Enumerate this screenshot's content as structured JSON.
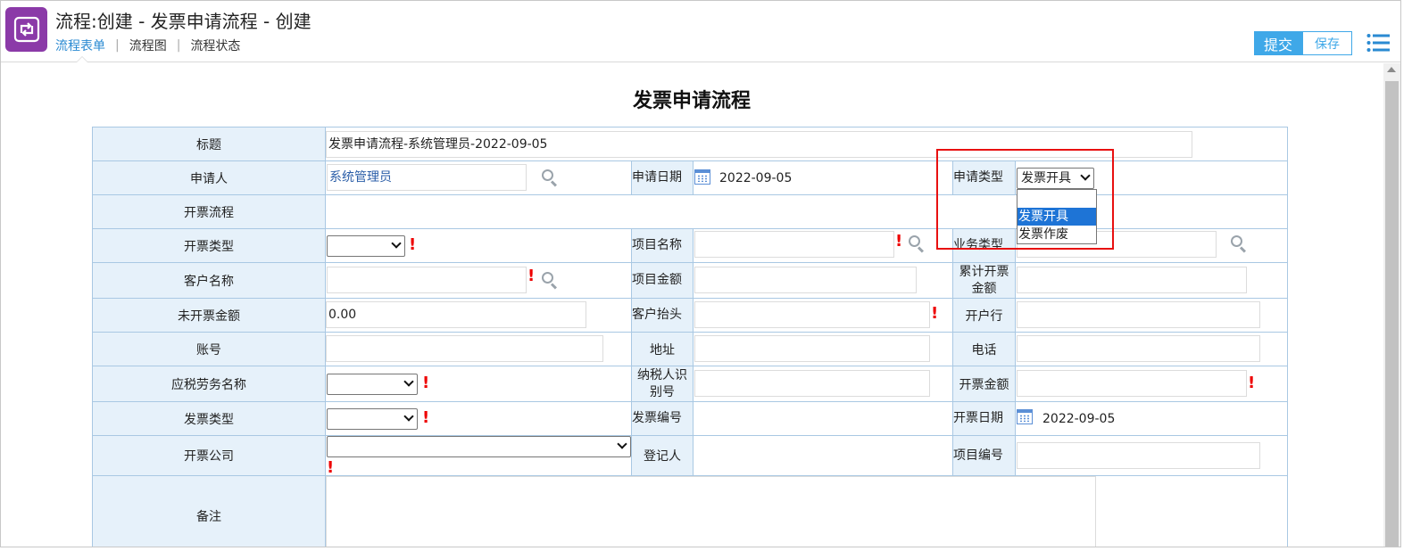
{
  "header": {
    "title": "流程:创建 - 发票申请流程 - 创建",
    "tabs": [
      {
        "label": "流程表单",
        "active": true
      },
      {
        "label": "流程图",
        "active": false
      },
      {
        "label": "流程状态",
        "active": false
      }
    ],
    "tab_separator": "|",
    "submit_label": "提交",
    "save_label": "保存",
    "accent_color": "#3fa8e8",
    "app_icon_color": "#8b3aa8"
  },
  "form": {
    "title": "发票申请流程",
    "labels": {
      "title": "标题",
      "applicant": "申请人",
      "apply_date": "申请日期",
      "apply_type": "申请类型",
      "invoice_flow": "开票流程",
      "invoice_kind": "开票类型",
      "project_name": "项目名称",
      "business_type": "业务类型",
      "customer_name": "客户名称",
      "project_amount": "项目金额",
      "cumulative_amount": "累计开票金额",
      "uninvoiced_amount": "未开票金额",
      "customer_header": "客户抬头",
      "bank": "开户行",
      "account": "账号",
      "address": "地址",
      "phone": "电话",
      "taxable_service": "应税劳务名称",
      "taxpayer_id": "纳税人识别号",
      "invoice_amount": "开票金额",
      "invoice_type": "发票类型",
      "invoice_no": "发票编号",
      "invoice_date": "开票日期",
      "invoice_company": "开票公司",
      "registrar": "登记人",
      "project_no": "项目编号",
      "remark": "备注"
    },
    "values": {
      "title": "发票申请流程-系统管理员-2022-09-05",
      "applicant": "系统管理员",
      "apply_date": "2022-09-05",
      "apply_type": "发票开具",
      "uninvoiced_amount": "0.00",
      "invoice_date": "2022-09-05"
    },
    "required_mark": "!",
    "apply_type_options": [
      "",
      "发票开具",
      "发票作废"
    ],
    "apply_type_highlighted": "发票开具"
  }
}
